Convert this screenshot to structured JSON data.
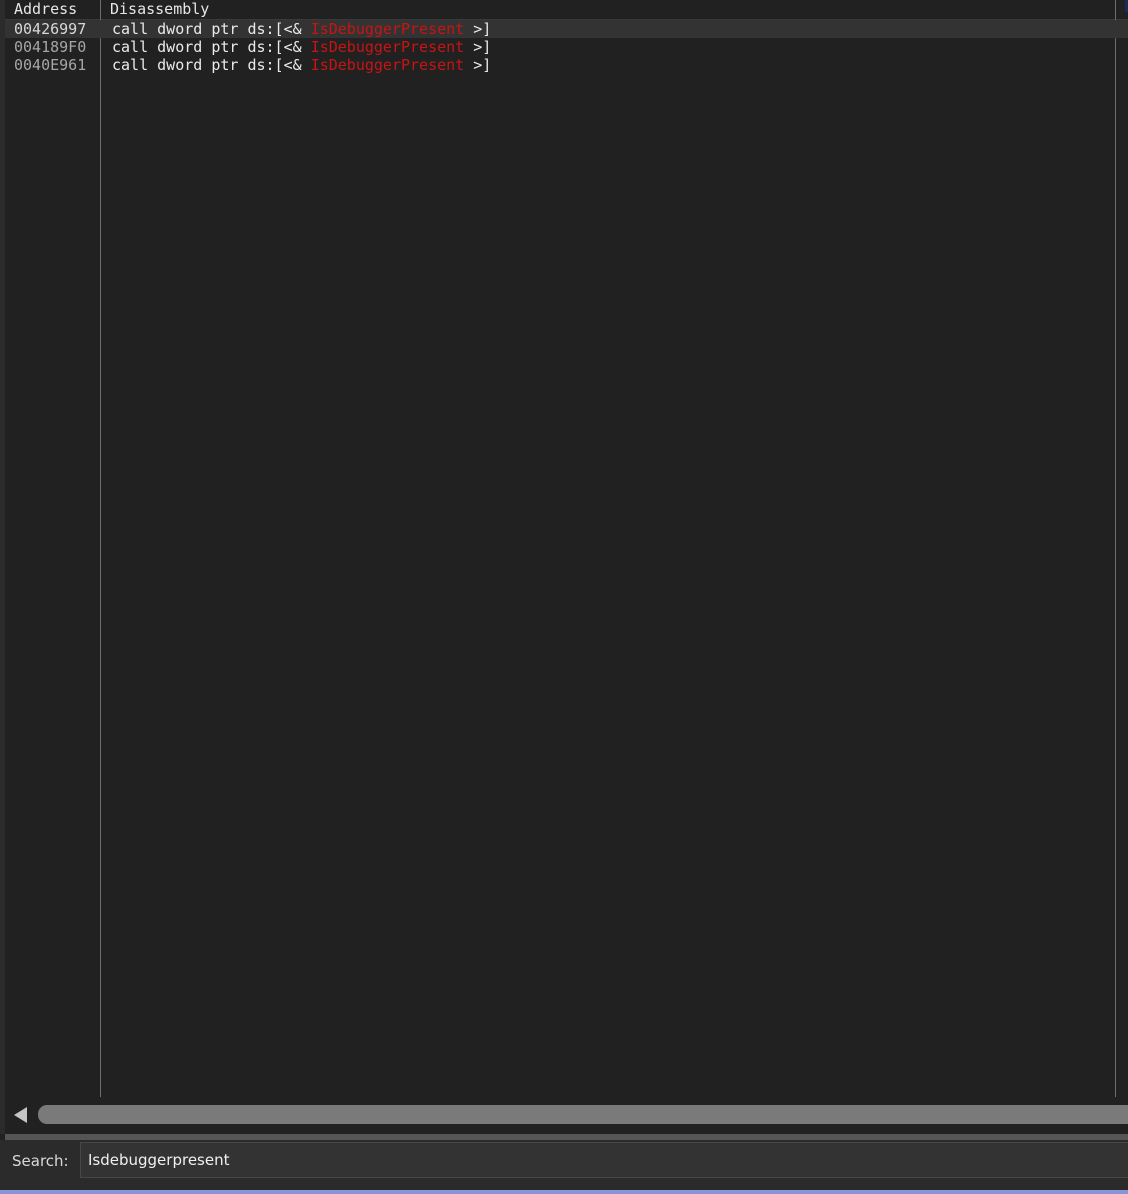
{
  "header": {
    "address_label": "Address",
    "disassembly_label": "Disassembly"
  },
  "results": [
    {
      "address": "00426997",
      "prefix": "call dword ptr ds:[<& ",
      "api": "IsDebuggerPresent",
      "suffix": " >]",
      "selected": true
    },
    {
      "address": "004189F0",
      "prefix": "call dword ptr ds:[<& ",
      "api": "IsDebuggerPresent",
      "suffix": " >]",
      "selected": false
    },
    {
      "address": "0040E961",
      "prefix": "call dword ptr ds:[<& ",
      "api": "IsDebuggerPresent",
      "suffix": " >]",
      "selected": false
    }
  ],
  "search": {
    "label": "Search:",
    "value": "Isdebuggerpresent"
  },
  "colors": {
    "background": "#212121",
    "api_highlight": "#c81414",
    "selected_row": "#333333"
  },
  "icons": {
    "scroll_left": "triangle-left"
  }
}
